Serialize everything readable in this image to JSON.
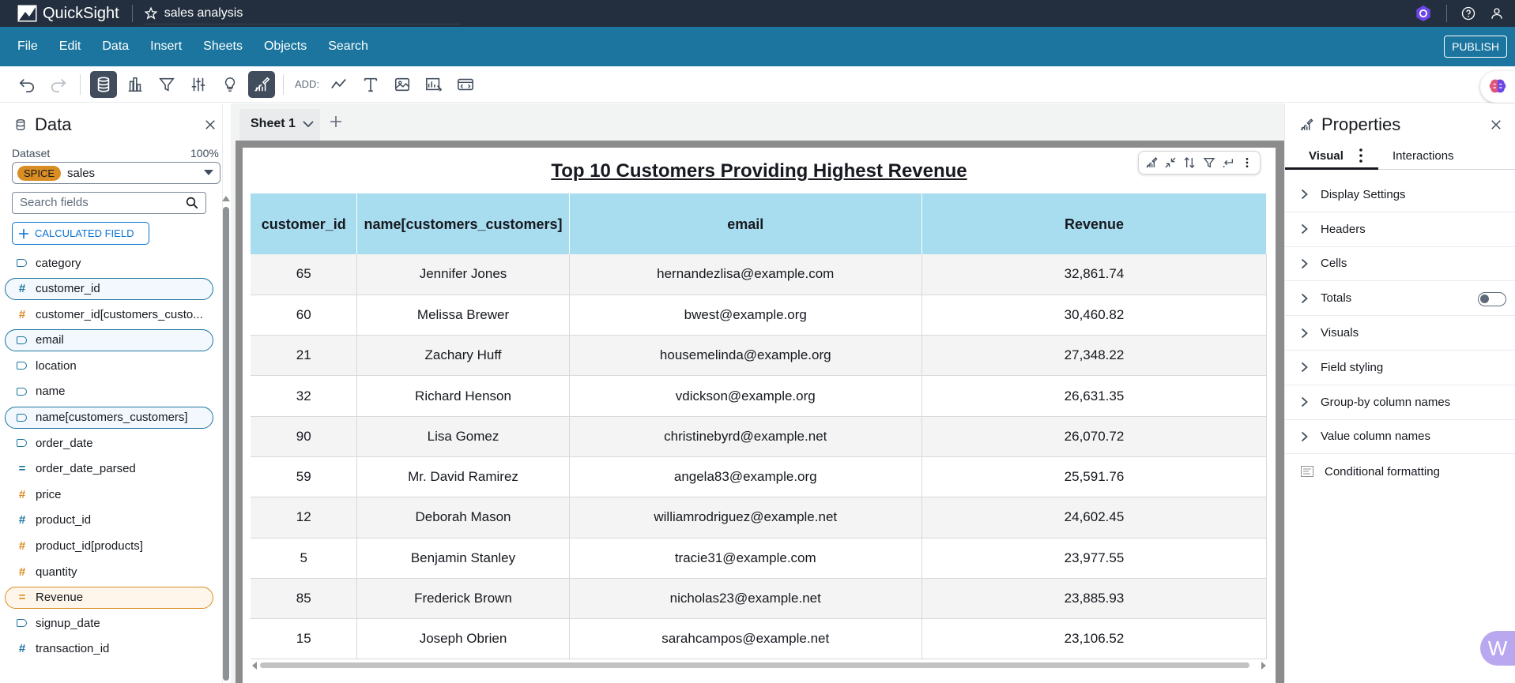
{
  "app": {
    "name": "QuickSight",
    "analysis_name": "sales analysis"
  },
  "menu": {
    "items": [
      "File",
      "Edit",
      "Data",
      "Insert",
      "Sheets",
      "Objects",
      "Search"
    ],
    "publish": "PUBLISH"
  },
  "toolbar": {
    "add_label": "ADD:"
  },
  "data_panel": {
    "title": "Data",
    "dataset_label": "Dataset",
    "dataset_percent": "100%",
    "dataset_badge": "SPICE",
    "dataset_name": "sales",
    "search_placeholder": "Search fields",
    "calculated_field_button": "CALCULATED FIELD",
    "fields": [
      {
        "name": "category",
        "icon": "tag-icon",
        "type": "dimension",
        "selected": ""
      },
      {
        "name": "customer_id",
        "icon": "hash-icon",
        "type": "dimension",
        "selected": "blue"
      },
      {
        "name": "customer_id[customers_custo...",
        "icon": "hash-icon",
        "type": "measure",
        "selected": ""
      },
      {
        "name": "email",
        "icon": "tag-icon",
        "type": "dimension",
        "selected": "blue"
      },
      {
        "name": "location",
        "icon": "tag-icon",
        "type": "dimension",
        "selected": ""
      },
      {
        "name": "name",
        "icon": "tag-icon",
        "type": "dimension",
        "selected": ""
      },
      {
        "name": "name[customers_customers]",
        "icon": "tag-icon",
        "type": "dimension",
        "selected": "blue"
      },
      {
        "name": "order_date",
        "icon": "tag-icon",
        "type": "dimension",
        "selected": ""
      },
      {
        "name": "order_date_parsed",
        "icon": "equals-icon",
        "type": "dimension",
        "selected": ""
      },
      {
        "name": "price",
        "icon": "hash-icon",
        "type": "measure",
        "selected": ""
      },
      {
        "name": "product_id",
        "icon": "hash-icon",
        "type": "dimension",
        "selected": ""
      },
      {
        "name": "product_id[products]",
        "icon": "hash-icon",
        "type": "measure",
        "selected": ""
      },
      {
        "name": "quantity",
        "icon": "hash-icon",
        "type": "measure",
        "selected": ""
      },
      {
        "name": "Revenue",
        "icon": "equals-icon",
        "type": "measure",
        "selected": "orange"
      },
      {
        "name": "signup_date",
        "icon": "tag-icon",
        "type": "dimension",
        "selected": ""
      },
      {
        "name": "transaction_id",
        "icon": "hash-icon",
        "type": "dimension",
        "selected": ""
      }
    ]
  },
  "sheet": {
    "tab_label": "Sheet 1"
  },
  "visual": {
    "title": "Top 10 Customers Providing Highest Revenue",
    "columns": [
      "customer_id",
      "name[customers_customers]",
      "email",
      "Revenue"
    ],
    "rows": [
      [
        "65",
        "Jennifer Jones",
        "hernandezlisa@example.com",
        "32,861.74"
      ],
      [
        "60",
        "Melissa Brewer",
        "bwest@example.org",
        "30,460.82"
      ],
      [
        "21",
        "Zachary Huff",
        "housemelinda@example.org",
        "27,348.22"
      ],
      [
        "32",
        "Richard Henson",
        "vdickson@example.org",
        "26,631.35"
      ],
      [
        "90",
        "Lisa Gomez",
        "christinebyrd@example.net",
        "26,070.72"
      ],
      [
        "59",
        "Mr. David Ramirez",
        "angela83@example.org",
        "25,591.76"
      ],
      [
        "12",
        "Deborah Mason",
        "williamrodriguez@example.net",
        "24,602.45"
      ],
      [
        "5",
        "Benjamin Stanley",
        "tracie31@example.com",
        "23,977.55"
      ],
      [
        "85",
        "Frederick Brown",
        "nicholas23@example.net",
        "23,885.93"
      ],
      [
        "15",
        "Joseph Obrien",
        "sarahcampos@example.net",
        "23,106.52"
      ]
    ]
  },
  "properties": {
    "title": "Properties",
    "tab_visual": "Visual",
    "tab_interactions": "Interactions",
    "sections": [
      "Display Settings",
      "Headers",
      "Cells",
      "Totals",
      "Visuals",
      "Field styling",
      "Group-by column names",
      "Value column names"
    ],
    "conditional_formatting": "Conditional formatting",
    "totals_toggle": false
  },
  "colors": {
    "topbar": "#232f3e",
    "menubar": "#1b759e",
    "header_fill": "#a8dcef",
    "accent_orange": "#d98d23",
    "link_blue": "#0972d3"
  }
}
